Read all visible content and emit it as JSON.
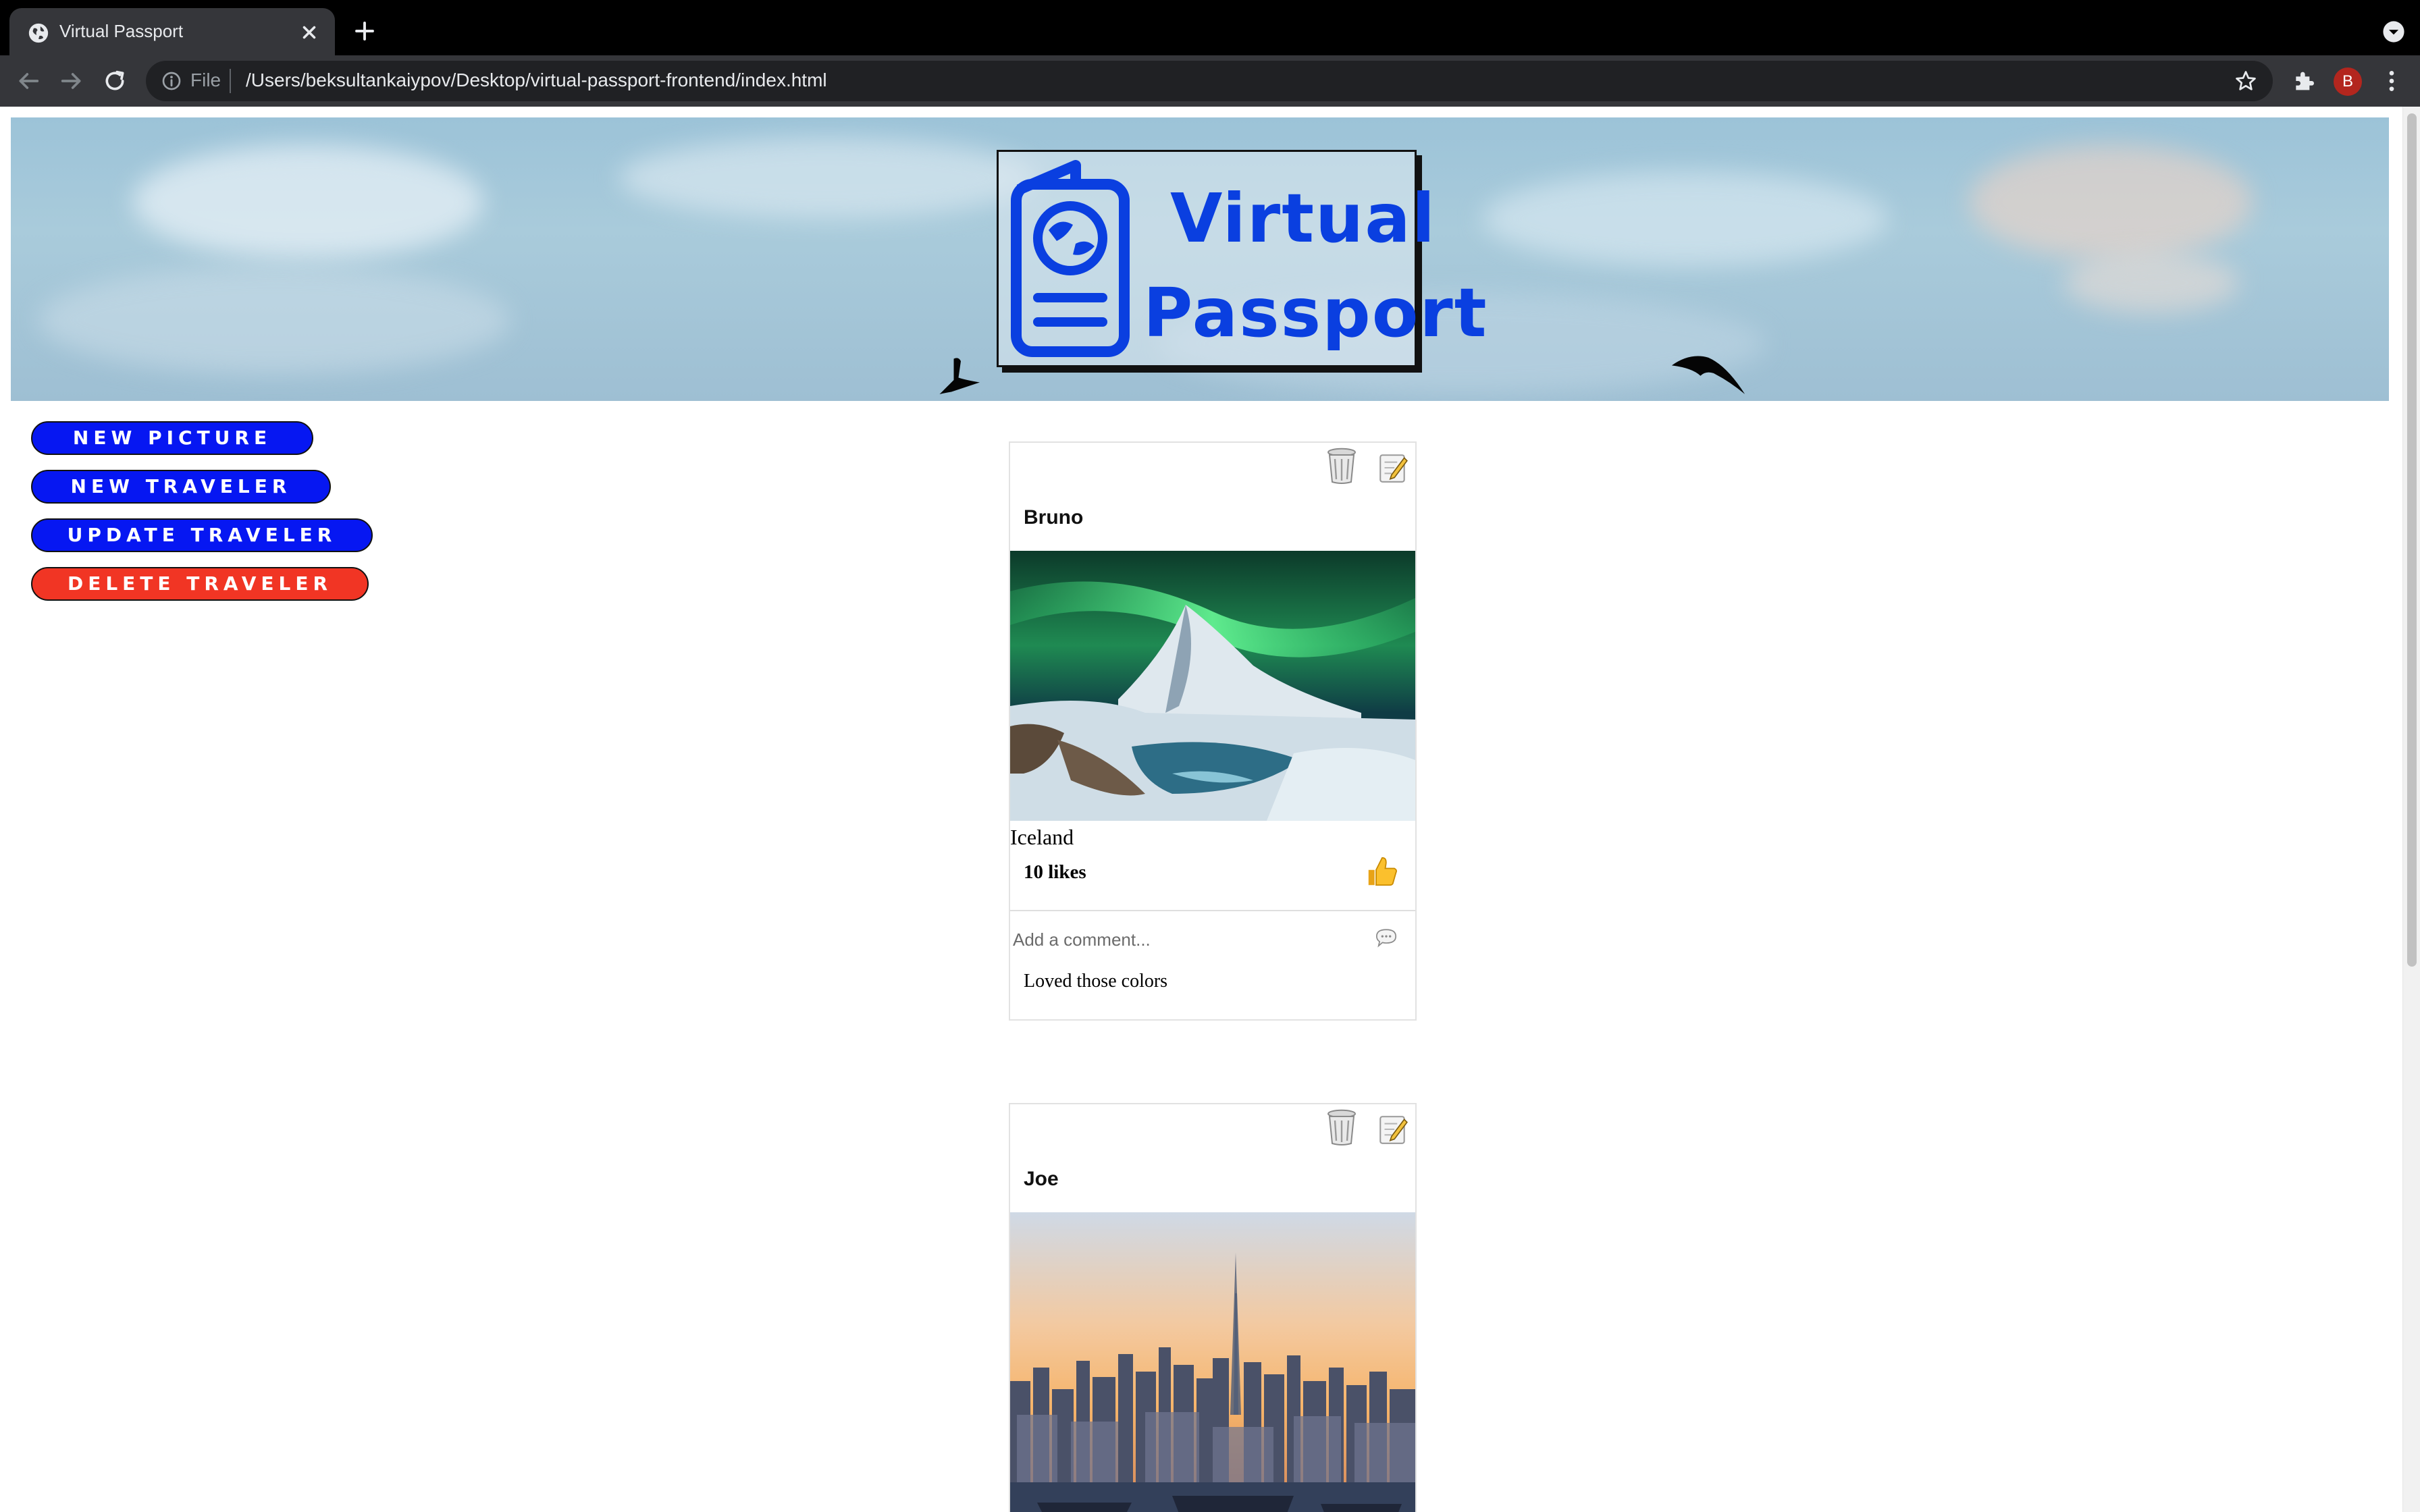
{
  "browser": {
    "tab_title": "Virtual Passport",
    "url_scheme": "File",
    "url": "/Users/beksultankaiypov/Desktop/virtual-passport-frontend/index.html",
    "profile_initial": "B"
  },
  "banner": {
    "logo_line1": "Virtual",
    "logo_line2": "Passport"
  },
  "actions": {
    "new_picture": "NEW PICTURE",
    "new_traveler": "NEW TRAVELER",
    "update_traveler": "UPDATE TRAVELER",
    "delete_traveler": "DELETE TRAVELER"
  },
  "posts": [
    {
      "traveler": "Bruno",
      "location": "Iceland",
      "likes": "10 likes",
      "comment_placeholder": "Add a comment...",
      "comments": [
        "Loved those colors"
      ]
    },
    {
      "traveler": "Joe"
    }
  ],
  "colors": {
    "primary_button": "#0617f2",
    "danger_button": "#f13524",
    "logo_blue": "#0a3fe0"
  }
}
